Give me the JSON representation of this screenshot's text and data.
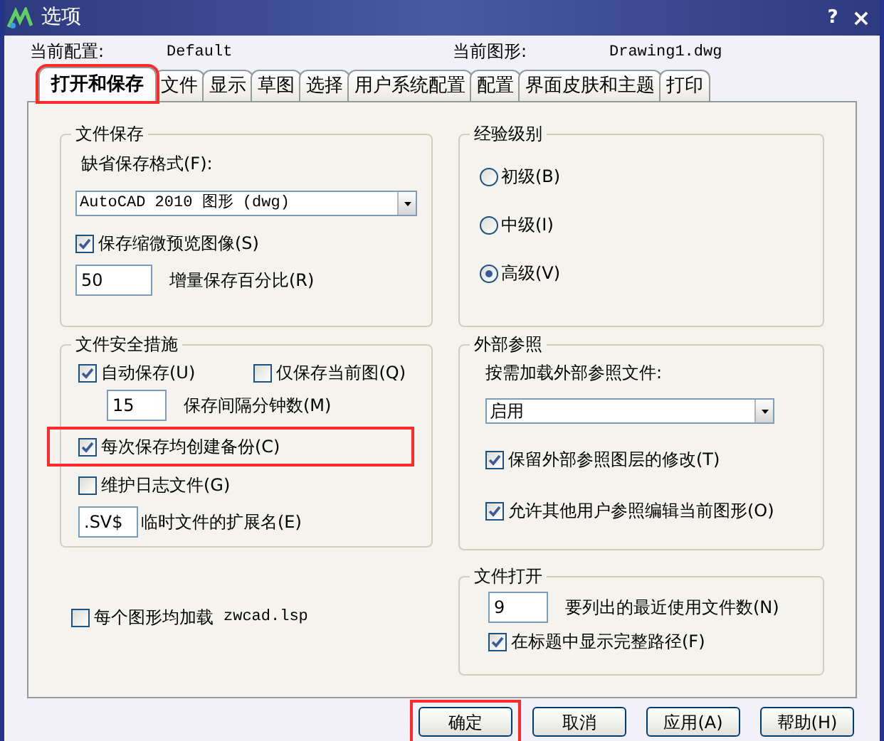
{
  "window": {
    "title": "选项",
    "help": "?",
    "close": "×"
  },
  "header": {
    "profile_label": "当前配置:",
    "profile": "Default",
    "drawing_label": "当前图形:",
    "drawing": "Drawing1.dwg"
  },
  "tabs": [
    {
      "label": "打开和保存",
      "selected": true,
      "highlighted": true
    },
    {
      "label": "文件",
      "selected": false,
      "highlighted": false
    },
    {
      "label": "显示",
      "selected": false,
      "highlighted": false
    },
    {
      "label": "草图",
      "selected": false,
      "highlighted": false
    },
    {
      "label": "选择",
      "selected": false,
      "highlighted": false
    },
    {
      "label": "用户系统配置",
      "selected": false,
      "highlighted": false
    },
    {
      "label": "配置",
      "selected": false,
      "highlighted": false
    },
    {
      "label": "界面皮肤和主题",
      "selected": false,
      "highlighted": false
    },
    {
      "label": "打印",
      "selected": false,
      "highlighted": false
    }
  ],
  "file_save": {
    "title": "文件保存",
    "format_label": "缺省保存格式(F):",
    "format": "AutoCAD 2010 图形 (dwg)",
    "thumbnail": {
      "label": "保存缩微预览图像(S)",
      "checked": true
    },
    "increment": {
      "value": "50",
      "label": "增量保存百分比(R)"
    }
  },
  "file_safety": {
    "title": "文件安全措施",
    "autosave": {
      "label": "自动保存(U)",
      "checked": true
    },
    "current_only": {
      "label": "仅保存当前图(Q)",
      "checked": false
    },
    "interval": {
      "value": "15",
      "label": "保存间隔分钟数(M)"
    },
    "backup": {
      "label": "每次保存均创建备份(C)",
      "checked": true,
      "highlighted": true
    },
    "log": {
      "label": "维护日志文件(G)",
      "checked": false
    },
    "temp_ext": {
      "value": ".SV$",
      "label": "临时文件的扩展名(E)"
    }
  },
  "load_lsp": {
    "label": "每个图形均加载",
    "file": "zwcad.lsp",
    "checked": false
  },
  "experience": {
    "title": "经验级别",
    "options": [
      {
        "label": "初级(B)",
        "selected": false
      },
      {
        "label": "中级(I)",
        "selected": false
      },
      {
        "label": "高级(V)",
        "selected": true
      }
    ]
  },
  "xref": {
    "title": "外部参照",
    "demand_label": "按需加载外部参照文件:",
    "demand": "启用",
    "checkboxes": [
      {
        "label": "保留外部参照图层的修改(T)",
        "checked": true
      },
      {
        "label": "允许其他用户参照编辑当前图形(O)",
        "checked": true
      }
    ]
  },
  "file_open": {
    "title": "文件打开",
    "recent": {
      "value": "9",
      "label": "要列出的最近使用文件数(N)"
    },
    "full_path": {
      "label": "在标题中显示完整路径(F)",
      "checked": true
    }
  },
  "buttons": [
    {
      "label": "确定",
      "highlighted": true
    },
    {
      "label": "取消",
      "highlighted": false
    },
    {
      "label": "应用(A)",
      "highlighted": false
    },
    {
      "label": "帮助(H)",
      "highlighted": false
    }
  ]
}
